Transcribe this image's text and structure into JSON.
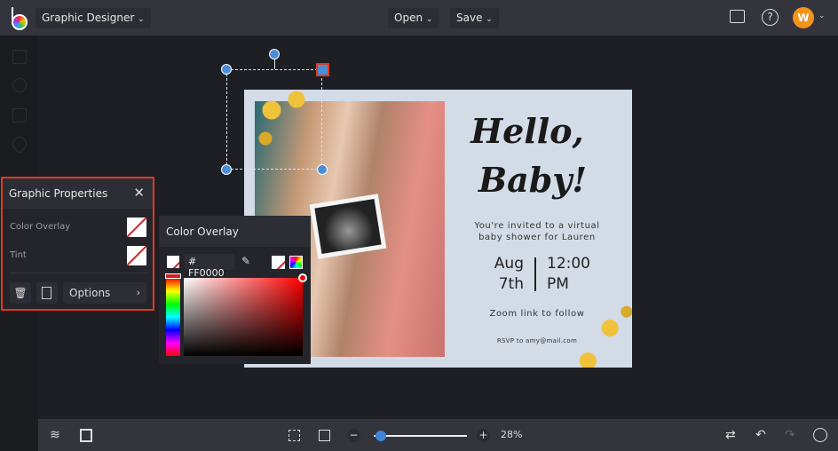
{
  "topbar": {
    "app_name": "Graphic Designer",
    "open_label": "Open",
    "save_label": "Save",
    "avatar_initial": "W"
  },
  "card": {
    "title_line1": "Hello,",
    "title_line2": "Baby!",
    "invite_line1": "You're invited to a virtual",
    "invite_line2": "baby shower for Lauren",
    "date_line1": "Aug",
    "date_line2": "7th",
    "time_line1": "12:00",
    "time_line2": "PM",
    "zoom_note": "Zoom link to follow",
    "rsvp": "RSVP to amy@mail.com"
  },
  "graphic_properties": {
    "title": "Graphic Properties",
    "color_overlay_label": "Color Overlay",
    "tint_label": "Tint",
    "options_label": "Options"
  },
  "color_overlay": {
    "title": "Color Overlay",
    "hex_value": "# FF0000",
    "accent": "#FF0000"
  },
  "bottombar": {
    "zoom_level": "28%",
    "zoom_fraction": 0.08
  }
}
